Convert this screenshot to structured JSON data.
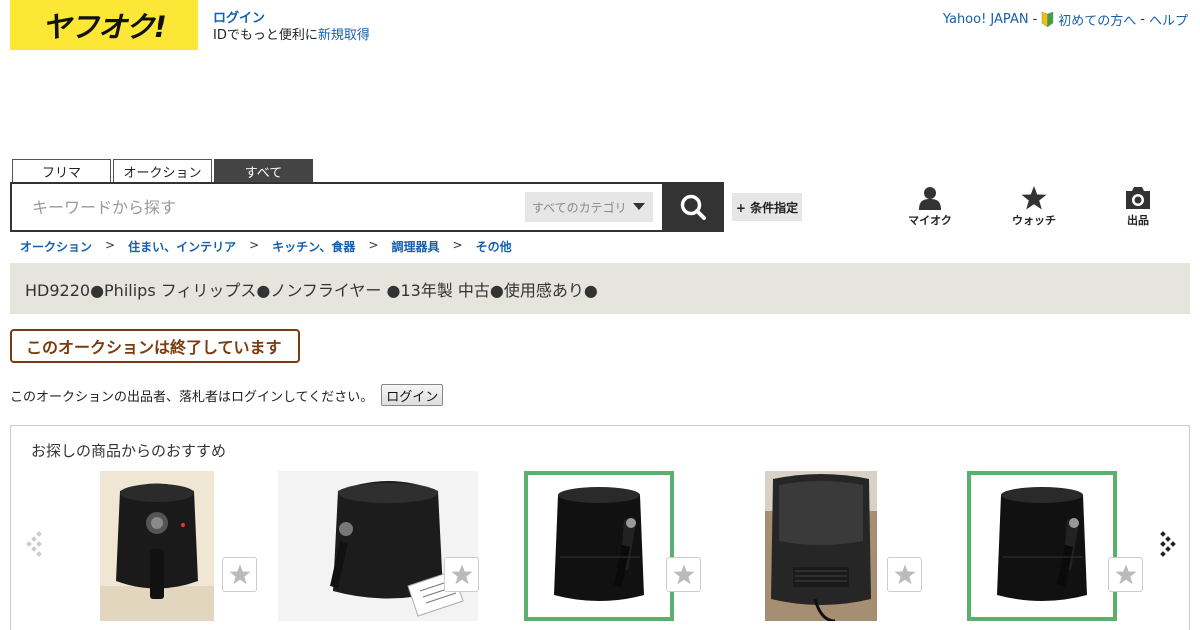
{
  "header": {
    "logo": "ヤフオク!",
    "login_link": "ログイン",
    "login_sub_prefix": "IDでもっと便利に",
    "register_link": "新規取得",
    "top_links": [
      {
        "label": "Yahoo! JAPAN",
        "sep": " - "
      },
      {
        "label": "初めての方へ",
        "sep": " - "
      },
      {
        "label": "ヘルプ",
        "sep": ""
      }
    ]
  },
  "search": {
    "tabs": [
      {
        "label": "フリマ",
        "active": false
      },
      {
        "label": "オークション",
        "active": false
      },
      {
        "label": "すべて",
        "active": true
      }
    ],
    "placeholder": "キーワードから探す",
    "category": "すべてのカテゴリ",
    "condition_button": "+ 条件指定"
  },
  "nav_icons": [
    {
      "label": "マイオク",
      "icon": "person-icon"
    },
    {
      "label": "ウォッチ",
      "icon": "star-icon"
    },
    {
      "label": "出品",
      "icon": "camera-icon"
    }
  ],
  "breadcrumb": [
    "オークション",
    "住まい、インテリア",
    "キッチン、食器",
    "調理器具",
    "その他"
  ],
  "item": {
    "title": "HD9220●Philips フィリップス●ノンフライヤー ●13年製 中古●使用感あり●",
    "ended_badge": "このオークションは終了しています",
    "login_message": "このオークションの出品者、落札者はログインしてください。",
    "login_button": "ログイン"
  },
  "recommendations": {
    "title": "お探しの商品からのおすすめ",
    "items": [
      {
        "name": "air-fryer-photo-1",
        "selected": false
      },
      {
        "name": "air-fryer-photo-2",
        "selected": false
      },
      {
        "name": "air-fryer-photo-3",
        "selected": true
      },
      {
        "name": "air-fryer-photo-4",
        "selected": false
      },
      {
        "name": "air-fryer-photo-5",
        "selected": true
      }
    ]
  },
  "colors": {
    "logo_bg": "#fce636",
    "link": "#1560ae",
    "ended": "#7a3c0e",
    "selected_border": "#5ab16e",
    "title_bar": "#e5e4dd"
  }
}
